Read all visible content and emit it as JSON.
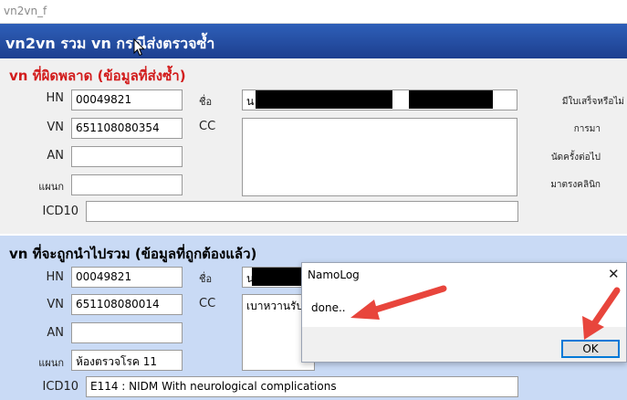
{
  "window": {
    "title": "vn2vn_f"
  },
  "header": {
    "text": "vn2vn รวม vn กรณีส่งตรวจซ้ำ"
  },
  "section_wrong": {
    "title": "vn ที่ผิดพลาด  (ข้อมูลที่ส่งซ้ำ)",
    "labels": {
      "hn": "HN",
      "vn": "VN",
      "an": "AN",
      "dept": "แผนก",
      "icd10": "ICD10",
      "name": "ชื่อ",
      "cc": "CC"
    },
    "values": {
      "hn": "00049821",
      "vn": "651108080354",
      "an": "",
      "dept": "",
      "icd10": "",
      "name_prefix": "น",
      "cc": ""
    },
    "right_labels": [
      "มีใบเสร็จหรือไม่",
      "การมา",
      "นัดครั้งต่อไป",
      "มาตรงคลินิก"
    ]
  },
  "section_right": {
    "title": "vn ที่จะถูกนำไปรวม (ข้อมูลที่ถูกต้องแล้ว)",
    "labels": {
      "hn": "HN",
      "vn": "VN",
      "an": "AN",
      "dept": "แผนก",
      "icd10": "ICD10",
      "name": "ชื่อ",
      "cc": "CC"
    },
    "values": {
      "hn": "00049821",
      "vn": "651108080014",
      "an": "",
      "dept": "ห้องตรวจโรค 11",
      "icd10": "E114 : NIDM With neurological complications",
      "name_prefix": "น",
      "cc": "เบาหวานรับยา"
    }
  },
  "dialog": {
    "title": "NamoLog",
    "message": "done..",
    "ok_label": "OK",
    "close_glyph": "✕"
  },
  "colors": {
    "accent": "#1d3f8f",
    "error_title": "#d21c1c",
    "section2_bg": "#c9daf5",
    "annotation_arrow": "#e8453c"
  }
}
